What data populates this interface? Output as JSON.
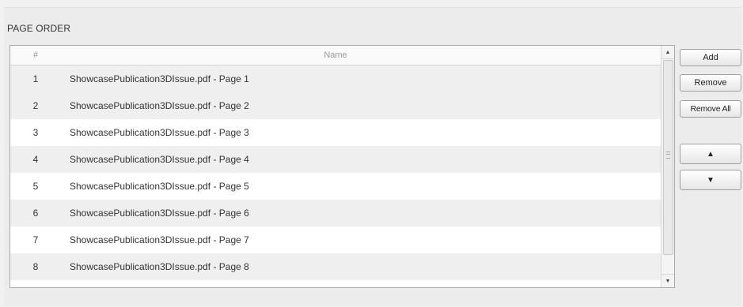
{
  "section": {
    "title": "PAGE ORDER"
  },
  "table": {
    "columns": {
      "number": "#",
      "name": "Name"
    },
    "rows": [
      {
        "num": "1",
        "name": "ShowcasePublication3DIssue.pdf - Page 1"
      },
      {
        "num": "2",
        "name": "ShowcasePublication3DIssue.pdf - Page 2"
      },
      {
        "num": "3",
        "name": "ShowcasePublication3DIssue.pdf - Page 3"
      },
      {
        "num": "4",
        "name": "ShowcasePublication3DIssue.pdf - Page 4"
      },
      {
        "num": "5",
        "name": "ShowcasePublication3DIssue.pdf - Page 5"
      },
      {
        "num": "6",
        "name": "ShowcasePublication3DIssue.pdf - Page 6"
      },
      {
        "num": "7",
        "name": "ShowcasePublication3DIssue.pdf - Page 7"
      },
      {
        "num": "8",
        "name": "ShowcasePublication3DIssue.pdf - Page 8"
      }
    ]
  },
  "buttons": {
    "add": "Add",
    "remove": "Remove",
    "remove_all": "Remove All",
    "move_up": "▲",
    "move_down": "▼"
  },
  "scrollbar": {
    "up_arrow": "▲",
    "down_arrow": "▼"
  },
  "icons": {
    "move_up": "triangle-up-icon",
    "move_down": "triangle-down-icon"
  }
}
